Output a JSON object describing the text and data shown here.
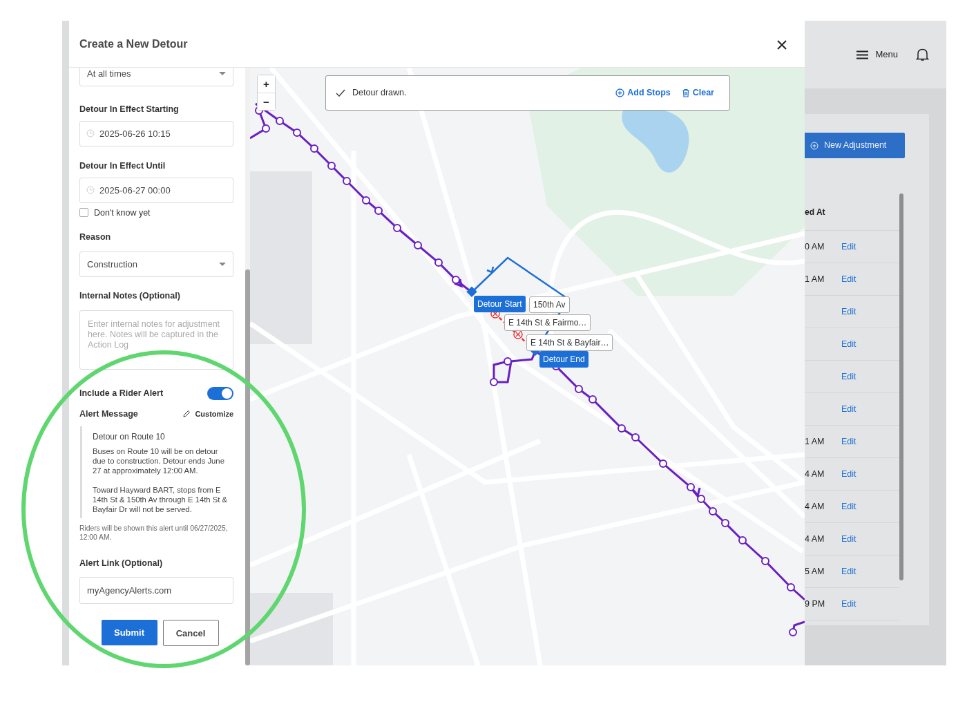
{
  "modal": {
    "title": "Create a New Detour"
  },
  "form": {
    "schedule": {
      "value": "At all times"
    },
    "start": {
      "label": "Detour In Effect Starting",
      "value": "2025-06-26 10:15"
    },
    "until": {
      "label": "Detour In Effect Until",
      "value": "2025-06-27 00:00"
    },
    "dont_know": {
      "label": "Don't know yet",
      "checked": false
    },
    "reason": {
      "label": "Reason",
      "value": "Construction"
    },
    "notes": {
      "label": "Internal Notes (Optional)",
      "placeholder": "Enter internal notes for adjustment here. Notes will be captured in the Action Log"
    },
    "rider_alert": {
      "label": "Include a Rider Alert",
      "on": true
    },
    "alert_message": {
      "label": "Alert Message",
      "customize": "Customize",
      "title": "Detour on Route 10",
      "paragraphs": [
        "Buses on Route 10 will be on detour due to construction. Detour ends June 27 at approximately 12:00 AM.",
        "Toward Hayward BART, stops from E 14th St & 150th Av through E 14th St & Bayfair Dr will not be served."
      ]
    },
    "alert_until": "Riders will be shown this alert until 06/27/2025, 12:00 AM.",
    "alert_link": {
      "label": "Alert Link (Optional)",
      "value": "myAgencyAlerts.com"
    },
    "buttons": [
      {
        "label": "Submit",
        "kind": "primary"
      },
      {
        "label": "Cancel",
        "kind": "secondary"
      }
    ]
  },
  "map": {
    "zoom_buttons": [
      "+",
      "−"
    ],
    "banner": {
      "text": "Detour drawn.",
      "actions": [
        {
          "label": "Add Stops",
          "kind": "add"
        },
        {
          "label": "Clear",
          "kind": "clear"
        }
      ]
    },
    "markers": [
      {
        "kind": "start",
        "label": "Detour Start"
      },
      {
        "kind": "end",
        "label": "Detour End"
      }
    ],
    "stop_labels": [
      "150th Av",
      "E 14th St & Fairmo…",
      "E 14th St & Bayfair…"
    ]
  },
  "background": {
    "menu": "Menu",
    "new_adjustment": "New Adjustment",
    "column": "ed At",
    "rows": [
      {
        "time": "0 AM",
        "action": "Edit"
      },
      {
        "time": "1 AM",
        "action": "Edit"
      },
      {
        "action": "Edit"
      },
      {
        "action": "Edit"
      },
      {
        "action": "Edit"
      },
      {
        "action": "Edit"
      },
      {
        "time": "1 AM",
        "action": "Edit"
      },
      {
        "time": "4 AM",
        "action": "Edit"
      },
      {
        "time": "4 AM",
        "action": "Edit"
      },
      {
        "time": "4 AM",
        "action": "Edit"
      },
      {
        "time": "5 AM",
        "action": "Edit"
      },
      {
        "time": "9 PM",
        "action": "Edit"
      }
    ]
  }
}
